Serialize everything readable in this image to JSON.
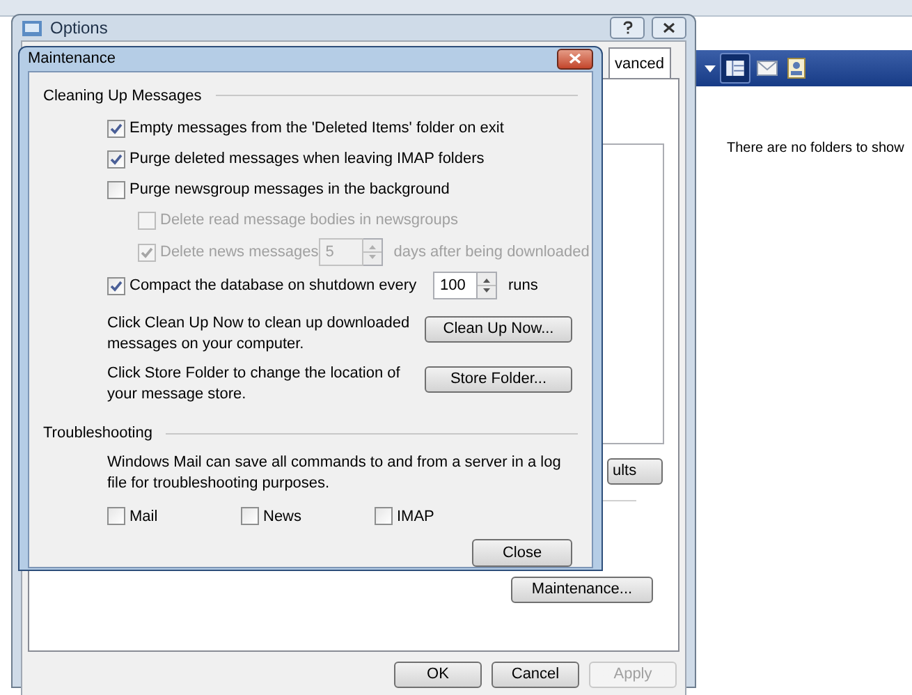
{
  "background_app": {
    "message": "There are no folders to show"
  },
  "options_window": {
    "title": "Options",
    "tab": {
      "label": "vanced",
      "selected": true
    },
    "partial_button": "ults",
    "maintenance_button": "Maintenance...",
    "buttons": [
      {
        "label": "OK",
        "disabled": false
      },
      {
        "label": "Cancel",
        "disabled": false
      },
      {
        "label": "Apply",
        "disabled": true
      }
    ]
  },
  "maintenance_dialog": {
    "title": "Maintenance",
    "cleaning": {
      "heading": "Cleaning Up Messages",
      "options": [
        {
          "kind": "checkbox",
          "label": "Empty messages from the 'Deleted Items' folder on exit",
          "checked": true,
          "disabled": false
        },
        {
          "kind": "checkbox",
          "label": "Purge deleted messages when leaving IMAP folders",
          "checked": true,
          "disabled": false
        },
        {
          "kind": "checkbox",
          "label": "Purge newsgroup messages in the background",
          "checked": false,
          "disabled": false,
          "children": [
            {
              "kind": "checkbox",
              "label": "Delete read message bodies in newsgroups",
              "checked": false,
              "disabled": true
            },
            {
              "kind": "spin",
              "label": "Delete news messages",
              "checked": true,
              "disabled": true,
              "value": "5",
              "suffix": "days after being downloaded"
            }
          ]
        },
        {
          "kind": "spin",
          "label": "Compact the database on shutdown every",
          "checked": true,
          "disabled": false,
          "value": "100",
          "suffix": "runs"
        }
      ],
      "actions": [
        {
          "text": "Click Clean Up Now to clean up downloaded messages on your computer.",
          "button": "Clean Up Now..."
        },
        {
          "text": "Click Store Folder to change the location of your message store.",
          "button": "Store Folder..."
        }
      ]
    },
    "troubleshooting": {
      "heading": "Troubleshooting",
      "description": "Windows Mail can save all commands to and from a server in a log file for troubleshooting purposes.",
      "checkboxes": [
        {
          "label": "Mail",
          "checked": false
        },
        {
          "label": "News",
          "checked": false
        },
        {
          "label": "IMAP",
          "checked": false
        }
      ]
    },
    "close_button": "Close"
  }
}
